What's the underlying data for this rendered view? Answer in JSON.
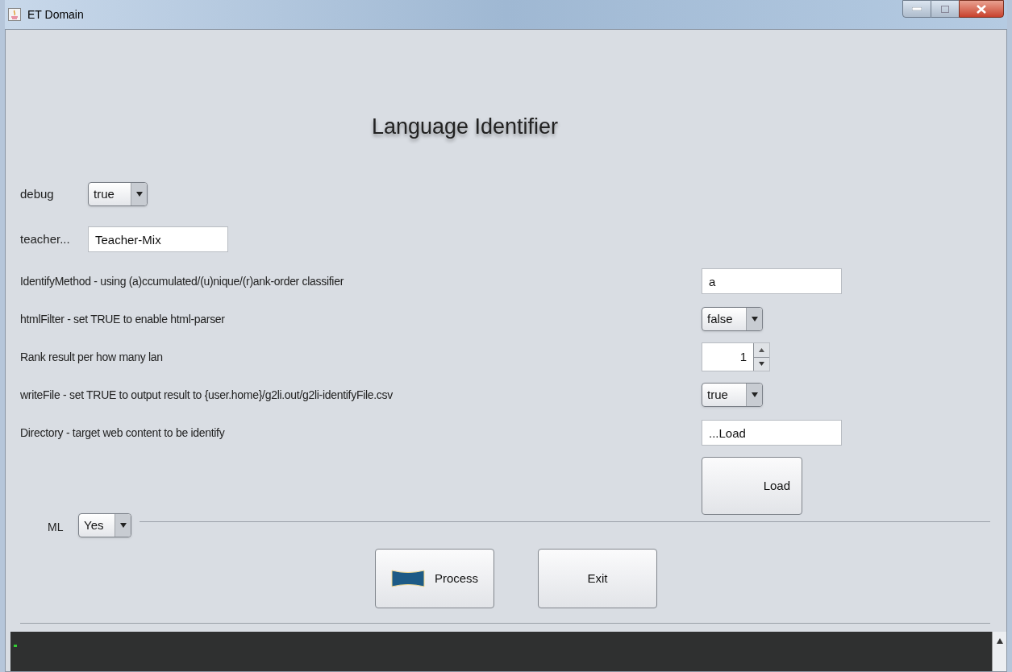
{
  "window": {
    "title": "ET Domain"
  },
  "heading": "Language Identifier",
  "top_fields": [
    {
      "label": "debug",
      "kind": "combo",
      "value": "true"
    },
    {
      "label": "teacher...",
      "kind": "text",
      "value": "Teacher-Mix"
    }
  ],
  "settings": [
    {
      "label": "IdentifyMethod - using (a)ccumulated/(u)nique/(r)ank-order classifier",
      "kind": "text",
      "value": "a"
    },
    {
      "label": "htmlFilter - set TRUE to enable html-parser",
      "kind": "combo",
      "value": "false"
    },
    {
      "label": "Rank result per how many lan",
      "kind": "spinner",
      "value": "1"
    },
    {
      "label": "writeFile - set TRUE to output result to {user.home}/g2li.out/g2li-identifyFile.csv",
      "kind": "combo",
      "value": "true"
    },
    {
      "label": "Directory - target web content to be identify",
      "kind": "text",
      "value": "...Load"
    }
  ],
  "load_button": "Load",
  "ml": {
    "label": "ML",
    "value": "Yes"
  },
  "buttons": [
    {
      "label": "Process",
      "kind": "icon"
    },
    {
      "label": "Exit",
      "kind": "plain"
    }
  ]
}
